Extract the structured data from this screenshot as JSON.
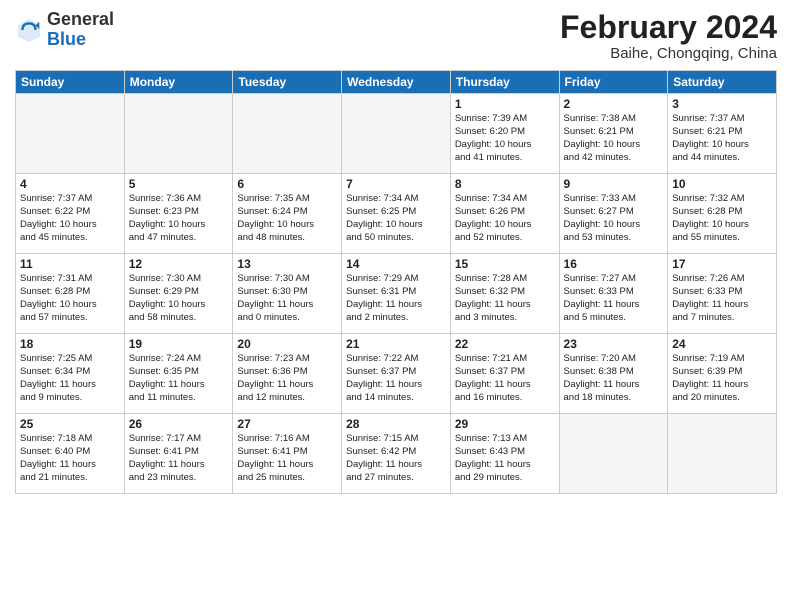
{
  "logo": {
    "general": "General",
    "blue": "Blue"
  },
  "title": {
    "month_year": "February 2024",
    "location": "Baihe, Chongqing, China"
  },
  "days_of_week": [
    "Sunday",
    "Monday",
    "Tuesday",
    "Wednesday",
    "Thursday",
    "Friday",
    "Saturday"
  ],
  "weeks": [
    [
      {
        "num": "",
        "info": ""
      },
      {
        "num": "",
        "info": ""
      },
      {
        "num": "",
        "info": ""
      },
      {
        "num": "",
        "info": ""
      },
      {
        "num": "1",
        "info": "Sunrise: 7:39 AM\nSunset: 6:20 PM\nDaylight: 10 hours\nand 41 minutes."
      },
      {
        "num": "2",
        "info": "Sunrise: 7:38 AM\nSunset: 6:21 PM\nDaylight: 10 hours\nand 42 minutes."
      },
      {
        "num": "3",
        "info": "Sunrise: 7:37 AM\nSunset: 6:21 PM\nDaylight: 10 hours\nand 44 minutes."
      }
    ],
    [
      {
        "num": "4",
        "info": "Sunrise: 7:37 AM\nSunset: 6:22 PM\nDaylight: 10 hours\nand 45 minutes."
      },
      {
        "num": "5",
        "info": "Sunrise: 7:36 AM\nSunset: 6:23 PM\nDaylight: 10 hours\nand 47 minutes."
      },
      {
        "num": "6",
        "info": "Sunrise: 7:35 AM\nSunset: 6:24 PM\nDaylight: 10 hours\nand 48 minutes."
      },
      {
        "num": "7",
        "info": "Sunrise: 7:34 AM\nSunset: 6:25 PM\nDaylight: 10 hours\nand 50 minutes."
      },
      {
        "num": "8",
        "info": "Sunrise: 7:34 AM\nSunset: 6:26 PM\nDaylight: 10 hours\nand 52 minutes."
      },
      {
        "num": "9",
        "info": "Sunrise: 7:33 AM\nSunset: 6:27 PM\nDaylight: 10 hours\nand 53 minutes."
      },
      {
        "num": "10",
        "info": "Sunrise: 7:32 AM\nSunset: 6:28 PM\nDaylight: 10 hours\nand 55 minutes."
      }
    ],
    [
      {
        "num": "11",
        "info": "Sunrise: 7:31 AM\nSunset: 6:28 PM\nDaylight: 10 hours\nand 57 minutes."
      },
      {
        "num": "12",
        "info": "Sunrise: 7:30 AM\nSunset: 6:29 PM\nDaylight: 10 hours\nand 58 minutes."
      },
      {
        "num": "13",
        "info": "Sunrise: 7:30 AM\nSunset: 6:30 PM\nDaylight: 11 hours\nand 0 minutes."
      },
      {
        "num": "14",
        "info": "Sunrise: 7:29 AM\nSunset: 6:31 PM\nDaylight: 11 hours\nand 2 minutes."
      },
      {
        "num": "15",
        "info": "Sunrise: 7:28 AM\nSunset: 6:32 PM\nDaylight: 11 hours\nand 3 minutes."
      },
      {
        "num": "16",
        "info": "Sunrise: 7:27 AM\nSunset: 6:33 PM\nDaylight: 11 hours\nand 5 minutes."
      },
      {
        "num": "17",
        "info": "Sunrise: 7:26 AM\nSunset: 6:33 PM\nDaylight: 11 hours\nand 7 minutes."
      }
    ],
    [
      {
        "num": "18",
        "info": "Sunrise: 7:25 AM\nSunset: 6:34 PM\nDaylight: 11 hours\nand 9 minutes."
      },
      {
        "num": "19",
        "info": "Sunrise: 7:24 AM\nSunset: 6:35 PM\nDaylight: 11 hours\nand 11 minutes."
      },
      {
        "num": "20",
        "info": "Sunrise: 7:23 AM\nSunset: 6:36 PM\nDaylight: 11 hours\nand 12 minutes."
      },
      {
        "num": "21",
        "info": "Sunrise: 7:22 AM\nSunset: 6:37 PM\nDaylight: 11 hours\nand 14 minutes."
      },
      {
        "num": "22",
        "info": "Sunrise: 7:21 AM\nSunset: 6:37 PM\nDaylight: 11 hours\nand 16 minutes."
      },
      {
        "num": "23",
        "info": "Sunrise: 7:20 AM\nSunset: 6:38 PM\nDaylight: 11 hours\nand 18 minutes."
      },
      {
        "num": "24",
        "info": "Sunrise: 7:19 AM\nSunset: 6:39 PM\nDaylight: 11 hours\nand 20 minutes."
      }
    ],
    [
      {
        "num": "25",
        "info": "Sunrise: 7:18 AM\nSunset: 6:40 PM\nDaylight: 11 hours\nand 21 minutes."
      },
      {
        "num": "26",
        "info": "Sunrise: 7:17 AM\nSunset: 6:41 PM\nDaylight: 11 hours\nand 23 minutes."
      },
      {
        "num": "27",
        "info": "Sunrise: 7:16 AM\nSunset: 6:41 PM\nDaylight: 11 hours\nand 25 minutes."
      },
      {
        "num": "28",
        "info": "Sunrise: 7:15 AM\nSunset: 6:42 PM\nDaylight: 11 hours\nand 27 minutes."
      },
      {
        "num": "29",
        "info": "Sunrise: 7:13 AM\nSunset: 6:43 PM\nDaylight: 11 hours\nand 29 minutes."
      },
      {
        "num": "",
        "info": ""
      },
      {
        "num": "",
        "info": ""
      }
    ]
  ]
}
